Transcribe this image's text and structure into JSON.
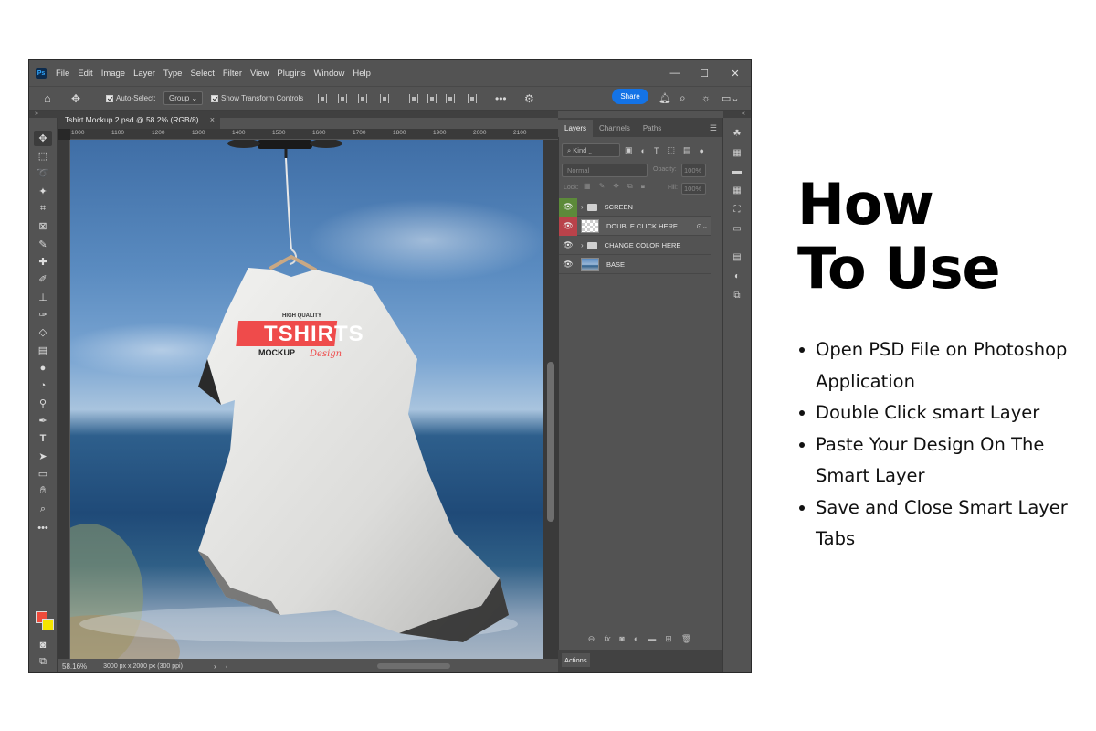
{
  "app": {
    "logo": "Ps",
    "menu": [
      "File",
      "Edit",
      "Image",
      "Layer",
      "Type",
      "Select",
      "Filter",
      "View",
      "Plugins",
      "Window",
      "Help"
    ],
    "window_controls": [
      "—",
      "☐",
      "✕"
    ]
  },
  "options_bar": {
    "auto_select_label": "Auto-Select:",
    "auto_select_value": "Group",
    "transform_controls_label": "Show Transform Controls",
    "share_label": "Share"
  },
  "document": {
    "tab_title": "Tshirt Mockup 2.psd @ 58.2% (RGB/8)",
    "close_glyph": "×",
    "ruler_labels": [
      "1000",
      "1100",
      "1200",
      "1300",
      "1400",
      "1500",
      "1600",
      "1700",
      "1800",
      "1900",
      "2000",
      "2100"
    ],
    "zoom": "58.16%",
    "doc_info": "3000 px x 2000 px (300 ppi)"
  },
  "artwork": {
    "line1": "HIGH QUALITY",
    "line2": "TSHIRTS",
    "line3": "MOCKUP",
    "line4": "Design"
  },
  "layers_panel": {
    "tabs": [
      "Layers",
      "Channels",
      "Paths"
    ],
    "filter_label": "Kind",
    "blend_mode": "Normal",
    "opacity_label": "Opacity:",
    "opacity_value": "100%",
    "lock_label": "Lock:",
    "fill_label": "Fill:",
    "fill_value": "100%",
    "layers": [
      {
        "name": "SCREEN",
        "type": "group",
        "eye": "green"
      },
      {
        "name": "DOUBLE CLICK HERE",
        "type": "smart",
        "eye": "red"
      },
      {
        "name": "CHANGE COLOR HERE",
        "type": "group",
        "eye": "none"
      },
      {
        "name": "BASE",
        "type": "photo",
        "eye": "none"
      }
    ],
    "actions_label": "Actions"
  },
  "instructions": {
    "title_line1": "How",
    "title_line2": "To Use",
    "steps": [
      "Open PSD File on Photoshop Application",
      "Double Click smart Layer",
      "Paste Your Design On The Smart Layer",
      "Save and Close Smart Layer Tabs"
    ]
  }
}
